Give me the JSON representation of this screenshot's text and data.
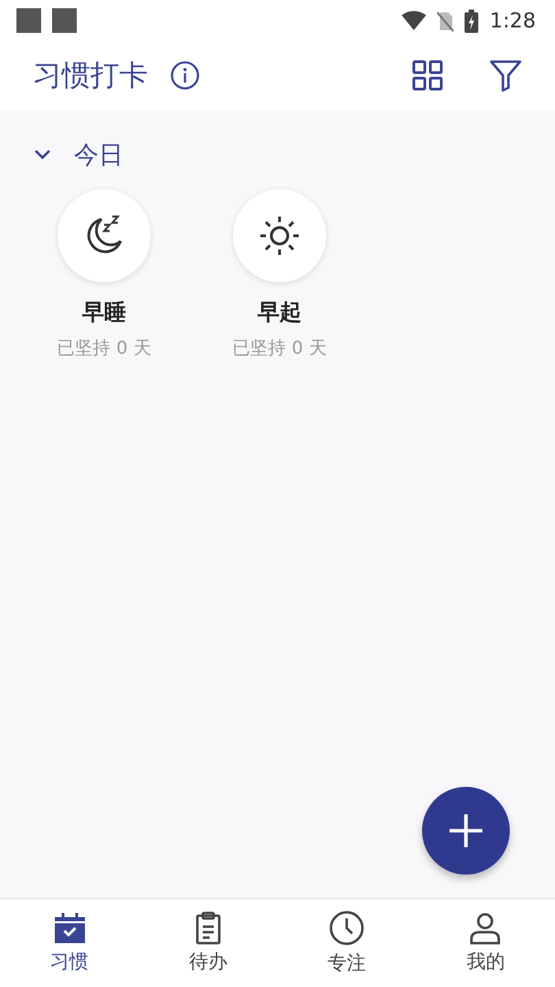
{
  "status_bar": {
    "time": "1:28"
  },
  "app_bar": {
    "title": "习惯打卡"
  },
  "section": {
    "title": "今日",
    "expanded": true
  },
  "habits": [
    {
      "name": "早睡",
      "streak": "已坚持 0 天",
      "kind": "moon"
    },
    {
      "name": "早起",
      "streak": "已坚持 0 天",
      "kind": "sun"
    }
  ],
  "tabs": [
    {
      "label": "习惯",
      "kind": "calendar",
      "selected": true
    },
    {
      "label": "待办",
      "kind": "clipboard",
      "selected": false
    },
    {
      "label": "专注",
      "kind": "clock",
      "selected": false
    },
    {
      "label": "我的",
      "kind": "person",
      "selected": false
    }
  ]
}
